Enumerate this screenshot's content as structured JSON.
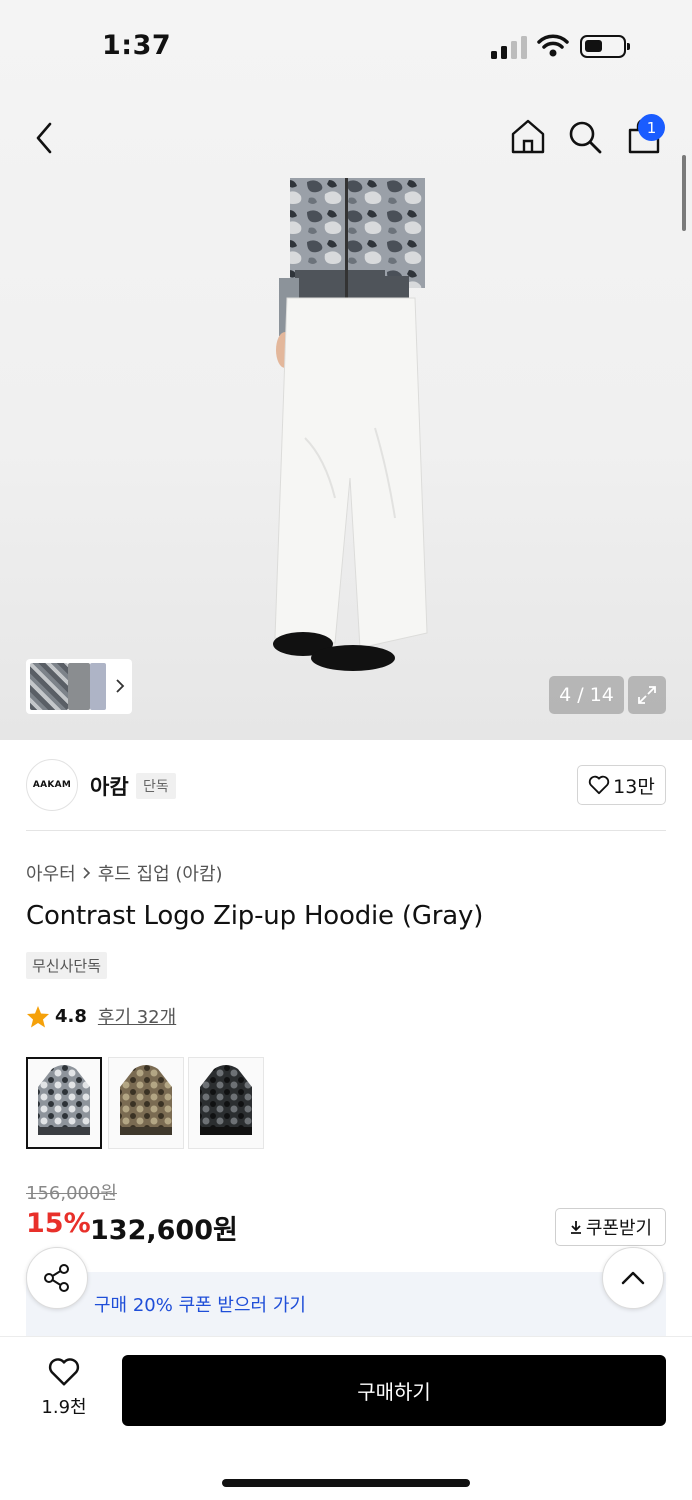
{
  "status_bar": {
    "time": "1:37"
  },
  "nav": {
    "cart_count": "1"
  },
  "gallery": {
    "counter": "4 / 14"
  },
  "brand": {
    "logo_text": "AAKAM",
    "name": "아캄",
    "tag": "단독",
    "likes": "13만"
  },
  "breadcrumb": {
    "category": "아우터",
    "subcategory": "후드 집업 (아캄)"
  },
  "product": {
    "title": "Contrast Logo Zip-up Hoodie (Gray)",
    "exclusive_tag": "무신사단독",
    "rating": "4.8",
    "reviews": "후기 32개",
    "original_price": "156,000원",
    "discount": "15%",
    "price": "132,600원",
    "coupon_button": "쿠폰받기",
    "coupon_banner": "구매 20% 쿠폰 받으러 가기",
    "color_options": [
      "gray-camo",
      "brown-camo",
      "black-camo"
    ]
  },
  "bottom": {
    "wish_count": "1.9천",
    "buy_label": "구매하기"
  },
  "colors": {
    "accent_red": "#e8302a",
    "badge_blue": "#1a5cff",
    "banner_blue": "#1f4ed8"
  },
  "icons": [
    "back-icon",
    "home-icon",
    "search-icon",
    "cart-icon",
    "expand-icon",
    "heart-icon",
    "star-icon",
    "download-icon",
    "share-icon",
    "chevron-up-icon"
  ]
}
